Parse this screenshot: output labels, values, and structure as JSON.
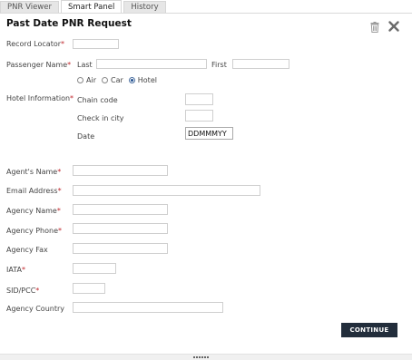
{
  "tabs": [
    {
      "label": "PNR Viewer",
      "active": false
    },
    {
      "label": "Smart Panel",
      "active": true
    },
    {
      "label": "History",
      "active": false
    }
  ],
  "panel": {
    "title": "Past Date PNR Request",
    "icons": [
      "trash-icon",
      "close-icon"
    ]
  },
  "form": {
    "record_locator": {
      "label": "Record Locator",
      "required_mark": "*",
      "value": ""
    },
    "passenger_name": {
      "label": "Passenger Name",
      "required_mark": "*",
      "last_label": "Last",
      "last_value": "",
      "first_label": "First",
      "first_value": ""
    },
    "booking_type": {
      "options": [
        "Air",
        "Car",
        "Hotel"
      ],
      "selected": "Hotel"
    },
    "hotel_information": {
      "label": "Hotel Information",
      "required_mark": "*",
      "chain_code_label": "Chain code",
      "chain_code_value": "",
      "check_in_city_label": "Check in city",
      "check_in_city_value": "",
      "date_label": "Date",
      "date_value": "DDMMMYY"
    },
    "agents_name": {
      "label": "Agent's Name",
      "required_mark": "*",
      "value": ""
    },
    "email_address": {
      "label": "Email Address",
      "required_mark": "*",
      "value": ""
    },
    "agency_name": {
      "label": "Agency Name",
      "required_mark": "*",
      "value": ""
    },
    "agency_phone": {
      "label": "Agency Phone",
      "required_mark": "*",
      "value": ""
    },
    "agency_fax": {
      "label": "Agency Fax",
      "value": ""
    },
    "iata": {
      "label": "IATA",
      "required_mark": "*",
      "value": ""
    },
    "sid_pcc": {
      "label": "SID/PCC",
      "required_mark": "*",
      "value": ""
    },
    "agency_country": {
      "label": "Agency Country",
      "value": ""
    }
  },
  "actions": {
    "continue_label": "CONTINUE"
  },
  "colors": {
    "required": "#c0282d",
    "button_bg": "#222d3b",
    "tab_inactive": "#e6e6e6"
  }
}
